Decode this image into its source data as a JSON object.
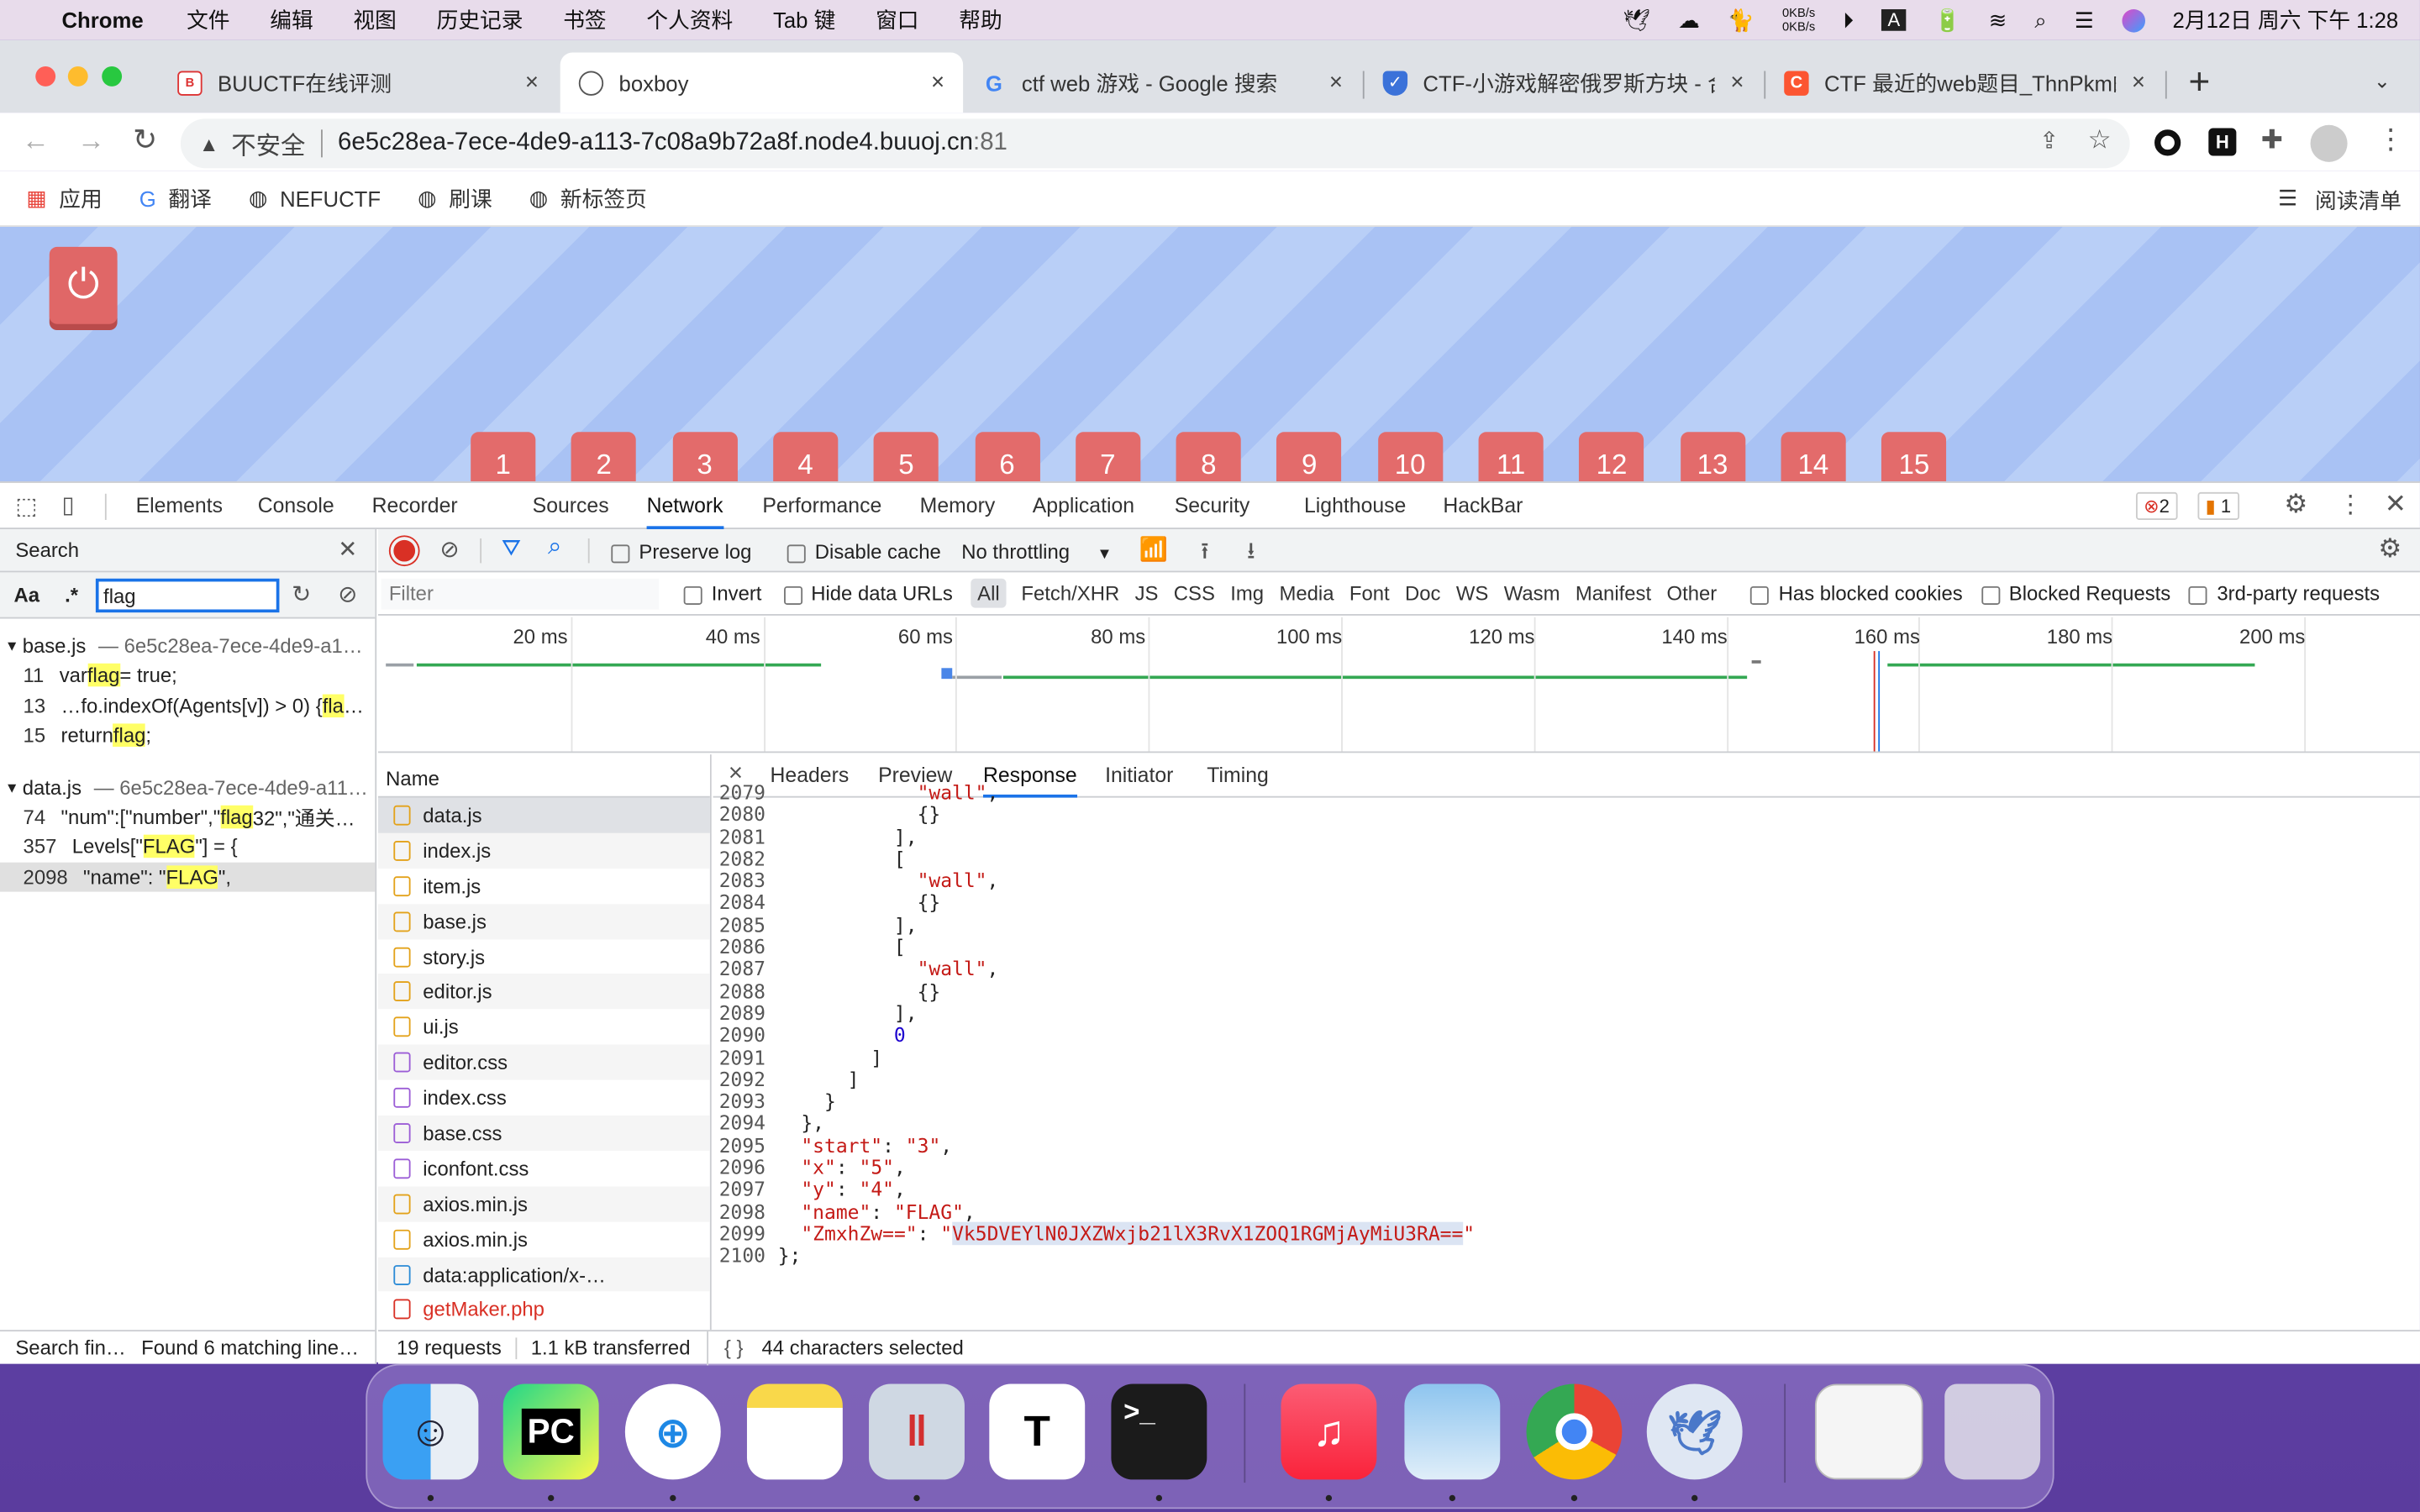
{
  "menubar": {
    "app": "Chrome",
    "items": [
      "文件",
      "编辑",
      "视图",
      "历史记录",
      "书签",
      "个人资料",
      "Tab 键",
      "窗口",
      "帮助"
    ],
    "net_up": "0KB/s",
    "net_down": "0KB/s",
    "datetime": "2月12日 周六 下午 1:28"
  },
  "tabs": [
    {
      "title": "BUUCTF在线评测",
      "close": "×"
    },
    {
      "title": "boxboy",
      "close": "×"
    },
    {
      "title": "ctf web 游戏 - Google 搜索",
      "close": "×"
    },
    {
      "title": "CTF-小游戏解密俄罗斯方块 - 合",
      "close": "×"
    },
    {
      "title": "CTF 最近的web题目_ThnPkm的",
      "close": "×"
    }
  ],
  "new_tab": "+",
  "omnibox": {
    "security": "不安全",
    "host": "6e5c28ea-7ece-4de9-a113-7c08a9b72a8f.node4.buuoj.cn",
    "port": ":81"
  },
  "bookmarks": [
    "应用",
    "翻译",
    "NEFUCTF",
    "刷课",
    "新标签页"
  ],
  "reading_list": "阅读清单",
  "levels": [
    "1",
    "2",
    "3",
    "4",
    "5",
    "6",
    "7",
    "8",
    "9",
    "10",
    "11",
    "12",
    "13",
    "14",
    "15"
  ],
  "devtools": {
    "tabs": [
      "Elements",
      "Console",
      "Recorder",
      "Sources",
      "Network",
      "Performance",
      "Memory",
      "Application",
      "Security",
      "Lighthouse",
      "HackBar"
    ],
    "errors": "2",
    "warnings": "1",
    "search": {
      "title": "Search",
      "aa": "Aa",
      "regex": ".*",
      "query": "flag",
      "results": [
        {
          "file": "base.js",
          "path": "— 6e5c28ea-7ece-4de9-a1…",
          "lines": [
            {
              "no": "11",
              "pre": "var ",
              "match": "flag",
              "post": " = true;"
            },
            {
              "no": "13",
              "pre": "…fo.indexOf(Agents[v]) > 0) { ",
              "match": "fla",
              "post": "…"
            },
            {
              "no": "15",
              "pre": "return ",
              "match": "flag",
              "post": ";"
            }
          ]
        },
        {
          "file": "data.js",
          "path": "— 6e5c28ea-7ece-4de9-a11…",
          "lines": [
            {
              "no": "74",
              "pre": "\"num\":[\"number\",\"",
              "match": "flag",
              "post": "32\",\"通关…"
            },
            {
              "no": "357",
              "pre": "Levels[\"",
              "match": "FLAG",
              "post": "\"] = {"
            },
            {
              "no": "2098",
              "pre": "\"name\": \"",
              "match": "FLAG",
              "post": "\","
            }
          ]
        }
      ],
      "status_left": "Search fin…",
      "status_right": "Found 6 matching line…"
    },
    "network": {
      "preserve_log": "Preserve log",
      "disable_cache": "Disable cache",
      "throttling": "No throttling",
      "filter_placeholder": "Filter",
      "invert": "Invert",
      "hide_data_urls": "Hide data URLs",
      "types": [
        "All",
        "Fetch/XHR",
        "JS",
        "CSS",
        "Img",
        "Media",
        "Font",
        "Doc",
        "WS",
        "Wasm",
        "Manifest",
        "Other"
      ],
      "has_blocked_cookies": "Has blocked cookies",
      "blocked_requests": "Blocked Requests",
      "third_party": "3rd-party requests",
      "timeline_ticks": [
        "20 ms",
        "40 ms",
        "60 ms",
        "80 ms",
        "100 ms",
        "120 ms",
        "140 ms",
        "160 ms",
        "180 ms",
        "200 ms"
      ],
      "name_header": "Name",
      "files": [
        {
          "name": "data.js",
          "kind": "js"
        },
        {
          "name": "index.js",
          "kind": "js"
        },
        {
          "name": "item.js",
          "kind": "js"
        },
        {
          "name": "base.js",
          "kind": "js"
        },
        {
          "name": "story.js",
          "kind": "js"
        },
        {
          "name": "editor.js",
          "kind": "js"
        },
        {
          "name": "ui.js",
          "kind": "js"
        },
        {
          "name": "editor.css",
          "kind": "css"
        },
        {
          "name": "index.css",
          "kind": "css"
        },
        {
          "name": "base.css",
          "kind": "css"
        },
        {
          "name": "iconfont.css",
          "kind": "css"
        },
        {
          "name": "axios.min.js",
          "kind": "js"
        },
        {
          "name": "axios.min.js",
          "kind": "js"
        },
        {
          "name": "data:application/x-…",
          "kind": "doc"
        },
        {
          "name": "getMaker.php",
          "kind": "php"
        }
      ],
      "detail_tabs": [
        "Headers",
        "Preview",
        "Response",
        "Initiator",
        "Timing"
      ],
      "close": "×",
      "requests": "19 requests",
      "transferred": "1.1 kB transferred",
      "selection": "44 characters selected",
      "braces": "{ }"
    },
    "response_lines": [
      {
        "no": "2079",
        "html": "            <span class='s'>\"wall\"</span>,"
      },
      {
        "no": "2080",
        "html": "            {}"
      },
      {
        "no": "2081",
        "html": "          ],"
      },
      {
        "no": "2082",
        "html": "          ["
      },
      {
        "no": "2083",
        "html": "            <span class='s'>\"wall\"</span>,"
      },
      {
        "no": "2084",
        "html": "            {}"
      },
      {
        "no": "2085",
        "html": "          ],"
      },
      {
        "no": "2086",
        "html": "          ["
      },
      {
        "no": "2087",
        "html": "            <span class='s'>\"wall\"</span>,"
      },
      {
        "no": "2088",
        "html": "            {}"
      },
      {
        "no": "2089",
        "html": "          ],"
      },
      {
        "no": "2090",
        "html": "          <span class='n'>0</span>"
      },
      {
        "no": "2091",
        "html": "        ]"
      },
      {
        "no": "2092",
        "html": "      ]"
      },
      {
        "no": "2093",
        "html": "    }"
      },
      {
        "no": "2094",
        "html": "  },"
      },
      {
        "no": "2095",
        "html": "  <span class='s'>\"start\"</span>: <span class='s'>\"3\"</span>,"
      },
      {
        "no": "2096",
        "html": "  <span class='s'>\"x\"</span>: <span class='s'>\"5\"</span>,"
      },
      {
        "no": "2097",
        "html": "  <span class='s'>\"y\"</span>: <span class='s'>\"4\"</span>,"
      },
      {
        "no": "2098",
        "html": "  <span class='s'>\"name\"</span>: <span class='s'>\"FLAG\"</span>,"
      },
      {
        "no": "2099",
        "html": "  <span class='s'>\"ZmxhZw==\"</span>: <span class='s'>\"<span class='sel-text'>Vk5DVEYlN0JXZWxjb21lX3RvX1ZOQ1RGMjAyMiU3RA==</span>\"</span>"
      },
      {
        "no": "2100",
        "html": "};"
      }
    ]
  },
  "dock": [
    "Finder",
    "PyCharm",
    "Safari",
    "Notes",
    "Parallels",
    "Typora",
    "Terminal",
    "Music",
    "Preview",
    "Chrome",
    "Burp",
    "Downloads",
    "Trash"
  ]
}
